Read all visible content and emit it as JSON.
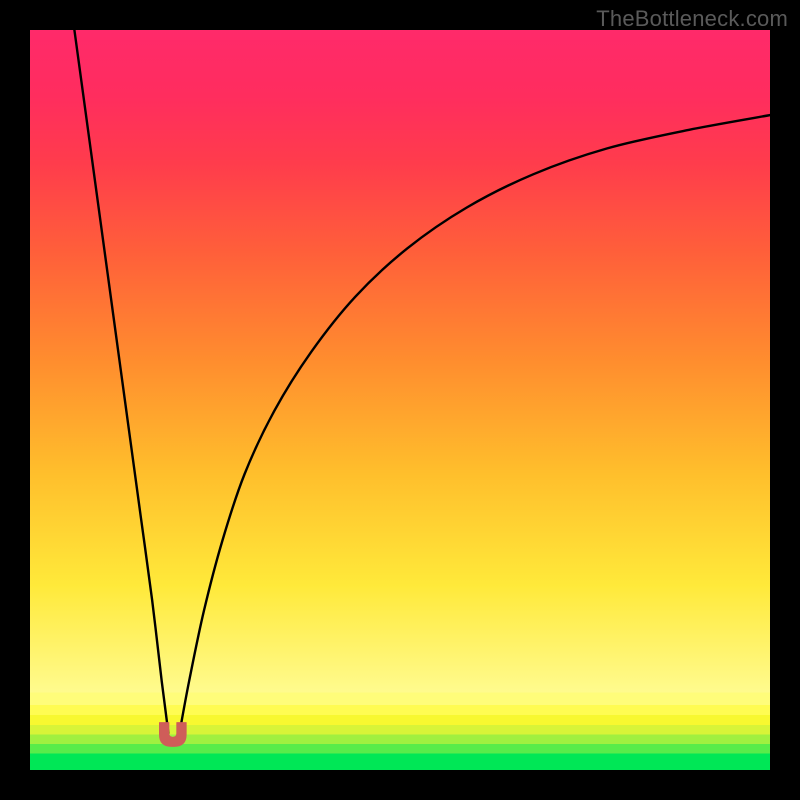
{
  "watermark": "TheBottleneck.com",
  "colors": {
    "frame": "#000000",
    "curve_stroke": "#000000",
    "marker_fill": "#cf5d59",
    "marker_stroke": "#cf5d59"
  },
  "chart_data": {
    "type": "line",
    "title": "",
    "xlabel": "",
    "ylabel": "",
    "xlim": [
      0,
      100
    ],
    "ylim": [
      0,
      100
    ],
    "grid": false,
    "legend": false,
    "note": "Values in percent of plot area; y=0 at bottom. Two branches of a V/cusp curve meeting near x≈19, y≈3.",
    "series": [
      {
        "name": "left-branch",
        "x": [
          6.0,
          7.5,
          9.0,
          10.5,
          12.0,
          13.5,
          15.0,
          16.5,
          17.8,
          18.7
        ],
        "y": [
          100.0,
          89.0,
          78.0,
          67.0,
          56.0,
          45.0,
          34.0,
          23.0,
          12.0,
          5.0
        ]
      },
      {
        "name": "right-branch",
        "x": [
          20.2,
          21.5,
          23.5,
          26.0,
          29.0,
          33.0,
          38.0,
          44.0,
          51.0,
          59.0,
          68.0,
          78.0,
          89.0,
          100.0
        ],
        "y": [
          5.0,
          12.0,
          21.5,
          31.0,
          40.0,
          48.5,
          56.5,
          64.0,
          70.5,
          76.0,
          80.5,
          84.0,
          86.5,
          88.5
        ]
      }
    ],
    "marker": {
      "shape": "u",
      "x": 19.3,
      "y": 3.2,
      "width_pct": 3.6,
      "height_pct": 3.2
    }
  }
}
